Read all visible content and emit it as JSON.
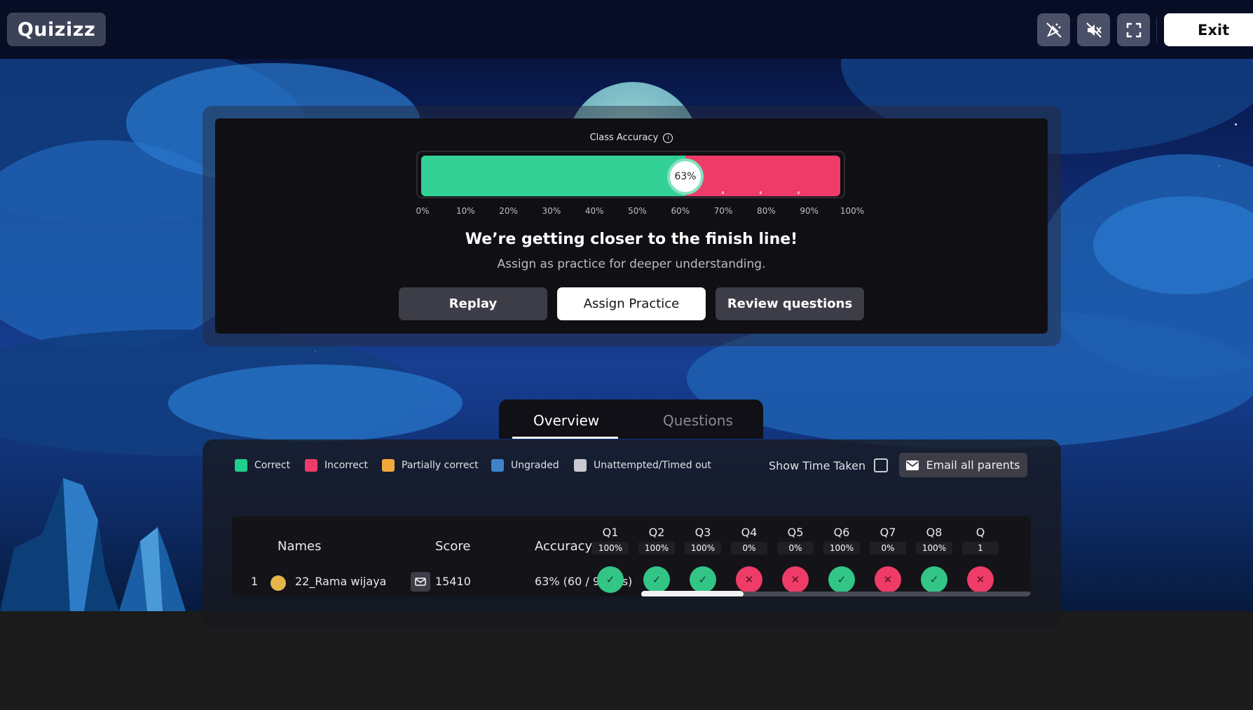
{
  "app": {
    "logo_text": "Quizizz",
    "exit_label": "Exit"
  },
  "toolbar": {
    "icons": [
      "celebration-off-icon",
      "sound-muted-icon",
      "fullscreen-icon"
    ]
  },
  "accuracy": {
    "title": "Class Accuracy",
    "value_label": "63%",
    "value": 63,
    "scale": [
      "0%",
      "10%",
      "20%",
      "30%",
      "40%",
      "50%",
      "60%",
      "70%",
      "80%",
      "90%",
      "100%"
    ],
    "colors": {
      "correct": "#33d196",
      "incorrect": "#ee3b68"
    }
  },
  "message": {
    "headline": "We’re getting closer to the finish line!",
    "subline": "Assign as practice for deeper understanding."
  },
  "actions": {
    "replay": "Replay",
    "assign_practice": "Assign Practice",
    "review_questions": "Review questions"
  },
  "tabs": {
    "overview": "Overview",
    "questions": "Questions",
    "active": "Overview"
  },
  "legend": {
    "correct": "Correct",
    "incorrect": "Incorrect",
    "partially_correct": "Partially correct",
    "ungraded": "Ungraded",
    "unattempted": "Unattempted/Timed out",
    "colors": {
      "correct": "#1fcf8c",
      "incorrect": "#ee3b68",
      "partially_correct": "#f2a93b",
      "ungraded": "#3f82c9",
      "unattempted": "#c9c9cf"
    }
  },
  "controls": {
    "show_time_taken": "Show Time Taken",
    "email_all_parents": "Email all parents"
  },
  "table": {
    "headers": {
      "names": "Names",
      "score": "Score",
      "accuracy": "Accuracy"
    },
    "questions": [
      {
        "label": "Q1",
        "pct": "100%"
      },
      {
        "label": "Q2",
        "pct": "100%"
      },
      {
        "label": "Q3",
        "pct": "100%"
      },
      {
        "label": "Q4",
        "pct": "0%"
      },
      {
        "label": "Q5",
        "pct": "0%"
      },
      {
        "label": "Q6",
        "pct": "100%"
      },
      {
        "label": "Q7",
        "pct": "0%"
      },
      {
        "label": "Q8",
        "pct": "100%"
      },
      {
        "label": "Q",
        "pct": "1"
      }
    ],
    "rows": [
      {
        "rank": "1",
        "name": "22_Rama wijaya",
        "score": "15410",
        "accuracy": "63% (60 / 96 pts)",
        "results": [
          "correct",
          "correct",
          "correct",
          "incorrect",
          "incorrect",
          "correct",
          "incorrect",
          "correct",
          "incorrect"
        ]
      }
    ]
  }
}
